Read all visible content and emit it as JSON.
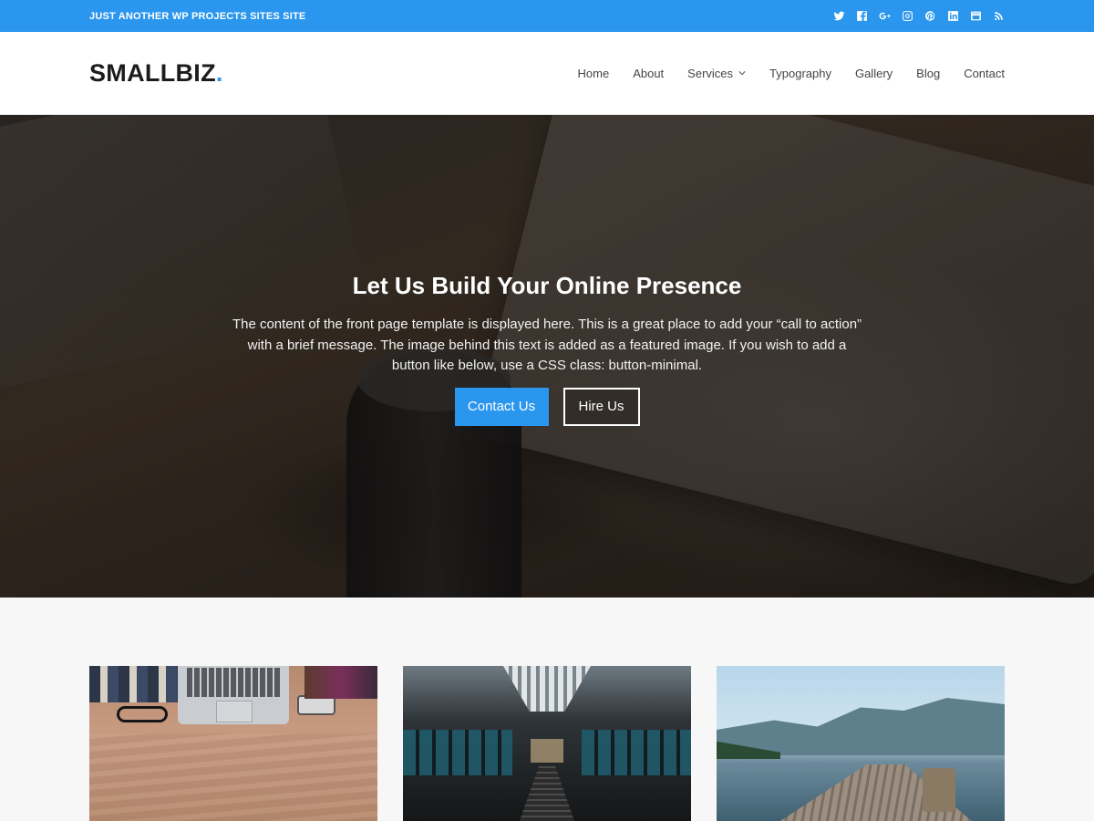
{
  "topbar": {
    "tagline": "JUST ANOTHER WP PROJECTS SITES SITE",
    "social_icons": [
      "twitter-icon",
      "facebook-icon",
      "google-plus-icon",
      "instagram-icon",
      "pinterest-icon",
      "linkedin-icon",
      "youtube-icon",
      "rss-icon"
    ]
  },
  "header": {
    "logo": "SMALLBIZ",
    "logo_dot": ".",
    "nav": [
      {
        "label": "Home"
      },
      {
        "label": "About"
      },
      {
        "label": "Services",
        "has_dropdown": true
      },
      {
        "label": "Typography"
      },
      {
        "label": "Gallery"
      },
      {
        "label": "Blog"
      },
      {
        "label": "Contact"
      }
    ]
  },
  "hero": {
    "title": "Let Us Build Your Online Presence",
    "text": "The content of the front page template is displayed here. This is a great place to add your “call to action” with a brief message. The image behind this text is added as a featured image. If you wish to add a button like below, use a CSS class: button-minimal.",
    "primary_button": "Contact Us",
    "secondary_button": "Hire Us"
  },
  "colors": {
    "accent": "#2a96ed",
    "topbar_bg": "#2a96ed",
    "page_bg": "#f7f7f7"
  }
}
